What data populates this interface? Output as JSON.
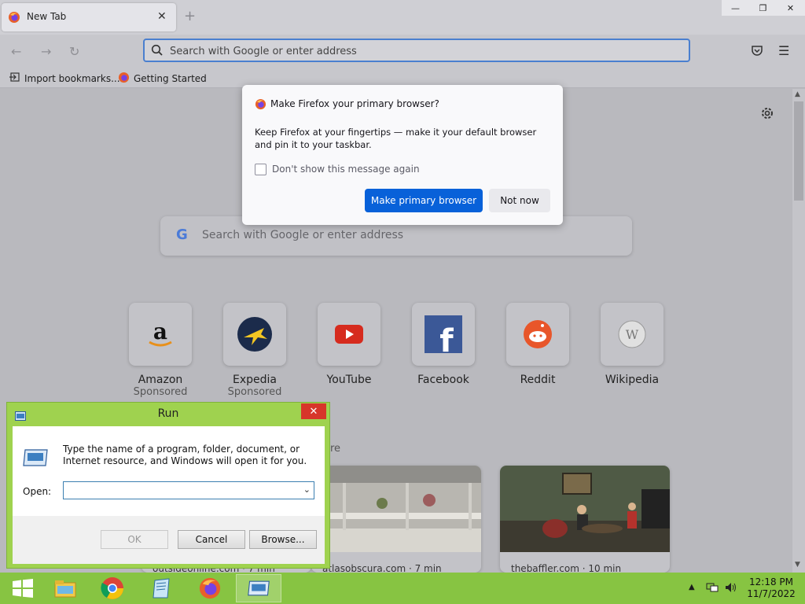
{
  "browser": {
    "tab": {
      "title": "New Tab"
    },
    "urlbar": {
      "placeholder": "Search with Google or enter address"
    },
    "bookmarks": [
      {
        "label": "Import bookmarks..."
      },
      {
        "label": "Getting Started"
      }
    ]
  },
  "newtab": {
    "search_placeholder": "Search with Google or enter address",
    "shortcuts": [
      {
        "label": "Amazon",
        "sub": "Sponsored"
      },
      {
        "label": "Expedia",
        "sub": "Sponsored"
      },
      {
        "label": "YouTube",
        "sub": ""
      },
      {
        "label": "Facebook",
        "sub": ""
      },
      {
        "label": "Reddit",
        "sub": ""
      },
      {
        "label": "Wikipedia",
        "sub": ""
      }
    ],
    "story_heading_fragment": "re",
    "stories": [
      {
        "source": "outsideonline.com · 7 min"
      },
      {
        "source": "atlasobscura.com · 7 min"
      },
      {
        "source": "thebaffler.com · 10 min"
      }
    ]
  },
  "ff_dialog": {
    "title": "Make Firefox your primary browser?",
    "body": "Keep Firefox at your fingertips — make it your default browser and pin it to your taskbar.",
    "checkbox_label": "Don't show this message again",
    "primary_label": "Make primary browser",
    "secondary_label": "Not now"
  },
  "run_dialog": {
    "title": "Run",
    "description": "Type the name of a program, folder, document, or Internet resource, and Windows will open it for you.",
    "open_label": "Open:",
    "open_value": "",
    "ok_label": "OK",
    "cancel_label": "Cancel",
    "browse_label": "Browse..."
  },
  "taskbar": {
    "time": "12:18 PM",
    "date": "11/7/2022"
  },
  "colors": {
    "taskbar": "#87c442",
    "accent_button": "#0861d9",
    "run_close": "#d7352a"
  }
}
